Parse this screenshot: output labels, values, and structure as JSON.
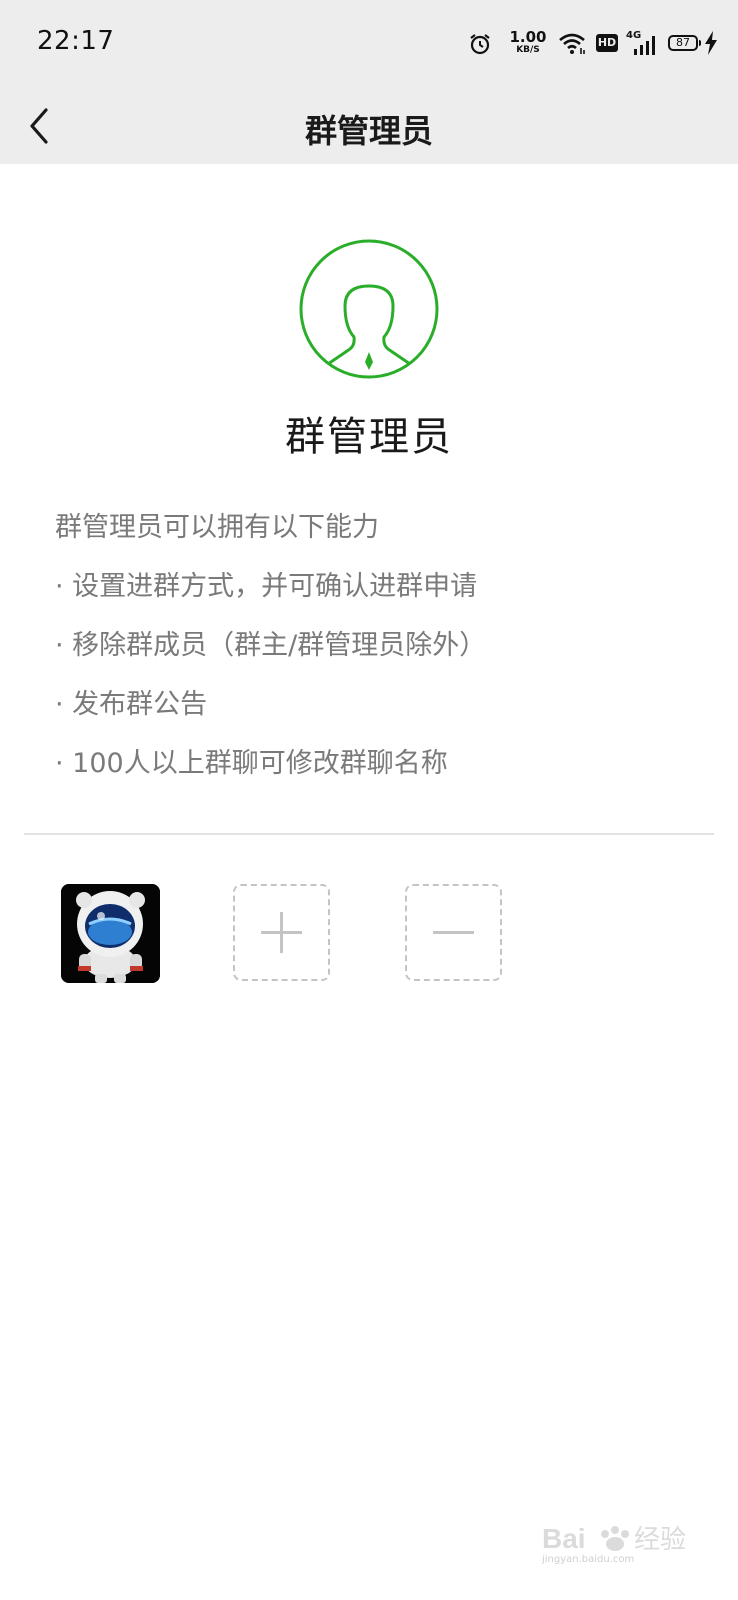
{
  "status_bar": {
    "time": "22:17",
    "net_speed_value": "1.00",
    "net_speed_unit": "KB/S",
    "hd_label": "HD",
    "network_type": "4G",
    "battery_level": "87"
  },
  "nav": {
    "title": "群管理员"
  },
  "hero": {
    "title": "群管理员",
    "icon_color": "#2aae2a"
  },
  "description": {
    "lines": [
      "群管理员可以拥有以下能力",
      "· 设置进群方式，并可确认进群申请",
      "· 移除群成员（群主/群管理员除外）",
      "· 发布群公告",
      "· 100人以上群聊可修改群聊名称"
    ]
  },
  "admins": {
    "add_icon": "plus-icon",
    "remove_icon": "minus-icon"
  },
  "watermark": {
    "brand": "Bai 经验",
    "url": "jingyan.baidu.com"
  }
}
